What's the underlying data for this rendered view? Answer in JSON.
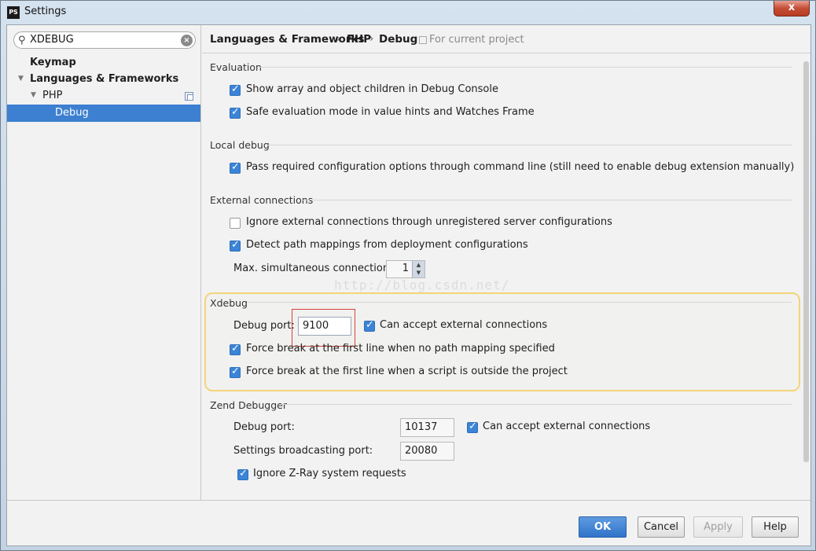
{
  "window": {
    "app_icon": "PS",
    "title": "Settings",
    "close_icon": "close-icon",
    "close_label": "x"
  },
  "sidebar": {
    "search": {
      "value": "XDEBUG",
      "icon": "search-icon",
      "clear_icon": "clear-icon"
    },
    "items": [
      {
        "label": "Keymap",
        "bold": true
      },
      {
        "label": "Languages & Frameworks",
        "bold": true,
        "expanded": true
      },
      {
        "label": "PHP",
        "bold": false,
        "expanded": true,
        "icon": "copy-icon"
      },
      {
        "label": "Debug",
        "bold": false,
        "selected": true
      }
    ]
  },
  "breadcrumb": {
    "parts": [
      "Languages & Frameworks",
      "PHP",
      "Debug"
    ],
    "separator": "›",
    "project_label": "For current project"
  },
  "sections": {
    "evaluation": {
      "title": "Evaluation",
      "options": [
        {
          "label": "Show array and object children in Debug Console",
          "checked": true
        },
        {
          "label": "Safe evaluation mode in value hints and Watches Frame",
          "checked": true
        }
      ]
    },
    "local_debug": {
      "title": "Local debug",
      "options": [
        {
          "label": "Pass required configuration options through command line (still need to enable debug extension manually)",
          "checked": true
        }
      ]
    },
    "external": {
      "title": "External connections",
      "options": [
        {
          "label": "Ignore external connections through unregistered server configurations",
          "checked": false
        },
        {
          "label": "Detect path mappings from deployment configurations",
          "checked": true
        }
      ],
      "max_label": "Max. simultaneous connections:",
      "max_value": "1"
    },
    "xdebug": {
      "title": "Xdebug",
      "port_label": "Debug port:",
      "port_value": "9100",
      "accept_label": "Can accept external connections",
      "accept_checked": true,
      "options": [
        {
          "label": "Force break at the first line when no path mapping specified",
          "checked": true
        },
        {
          "label": "Force break at the first line when a script is outside the project",
          "checked": true
        }
      ]
    },
    "zend": {
      "title": "Zend Debugger",
      "port_label": "Debug port:",
      "port_value": "10137",
      "accept_label": "Can accept external connections",
      "accept_checked": true,
      "broadcast_label": "Settings broadcasting port:",
      "broadcast_value": "20080",
      "zray_label": "Ignore Z-Ray system requests",
      "zray_checked": true
    }
  },
  "watermark": "http://blog.csdn.net/",
  "buttons": {
    "ok": "OK",
    "cancel": "Cancel",
    "apply": "Apply",
    "help": "Help"
  },
  "colors": {
    "accent": "#3d7fd0",
    "highlight_border": "#f4d37a",
    "marker_red": "#d9403a"
  }
}
